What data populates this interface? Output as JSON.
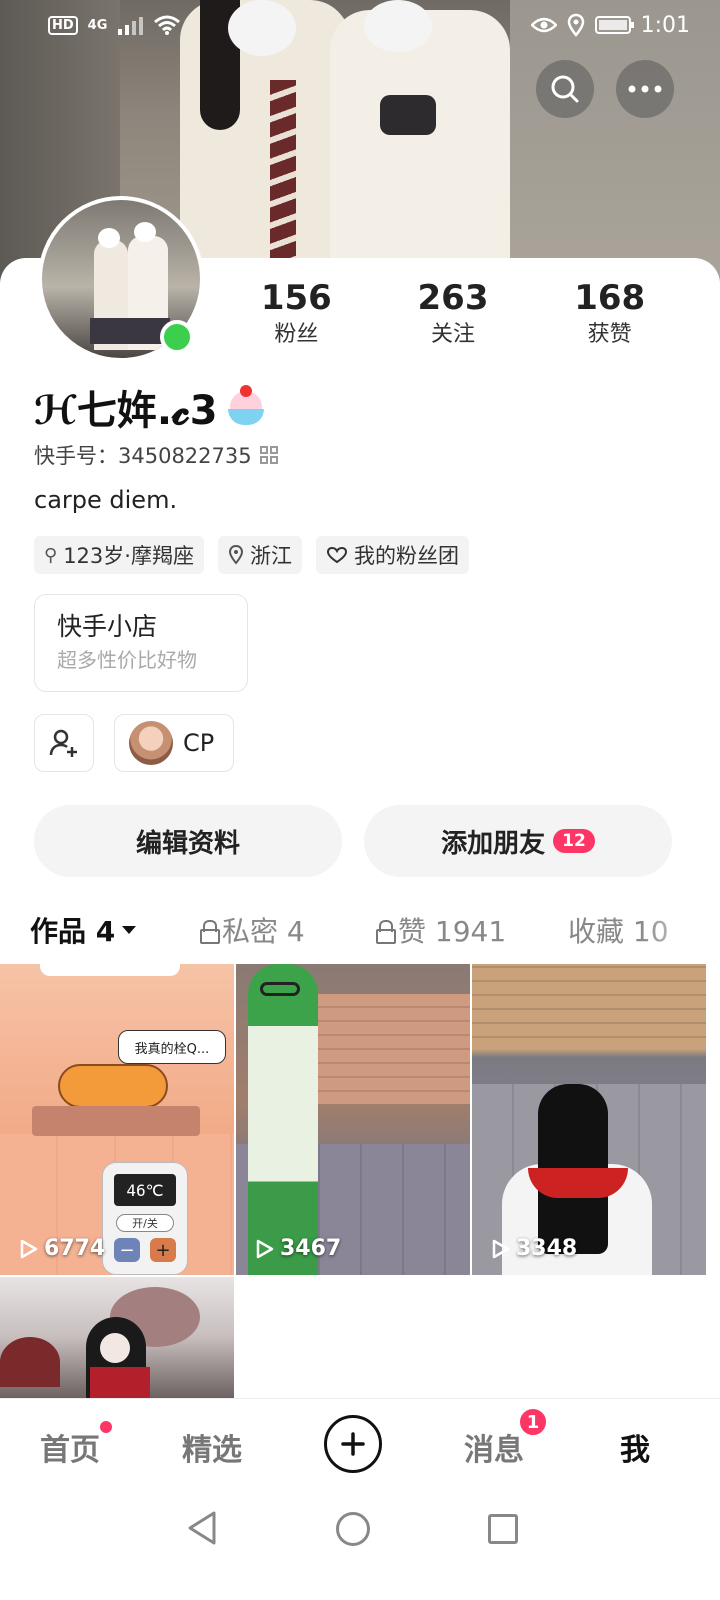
{
  "status_bar": {
    "network_badge": "HD",
    "network_type": "4G",
    "time": "1:01"
  },
  "header": {
    "search_icon": "search-icon",
    "more_icon": "more-icon"
  },
  "profile": {
    "nickname": "ℋ七姩.𝓬3",
    "kuaishou_id_label": "快手号：",
    "kuaishou_id": "3450822735",
    "bio": "carpe diem.",
    "online": true,
    "online_color": "#3ccf4e"
  },
  "stats": [
    {
      "value": "156",
      "label": "粉丝"
    },
    {
      "value": "263",
      "label": "关注"
    },
    {
      "value": "168",
      "label": "获赞"
    }
  ],
  "tags": [
    {
      "icon": "gender-icon",
      "label": "123岁·摩羯座"
    },
    {
      "icon": "location-icon",
      "label": "浙江"
    },
    {
      "icon": "heart-icon",
      "label": "我的粉丝团"
    }
  ],
  "shop": {
    "title": "快手小店",
    "subtitle": "超多性价比好物"
  },
  "cp": {
    "label": "CP"
  },
  "actions": {
    "edit_profile": "编辑资料",
    "add_friends": "添加朋友",
    "add_friends_badge": "12"
  },
  "tabs": [
    {
      "label": "作品 4",
      "locked": false,
      "active": true
    },
    {
      "label": "私密 4",
      "locked": true,
      "active": false
    },
    {
      "label": "赞 1941",
      "locked": true,
      "active": false
    },
    {
      "label": "收藏 10",
      "locked": false,
      "active": false
    }
  ],
  "works": [
    {
      "plays": "6774",
      "bubble_text": "我真的栓Q...",
      "remote_temp": "46℃",
      "remote_button": "开/关"
    },
    {
      "plays": "3467"
    },
    {
      "plays": "3348"
    },
    {
      "plays": ""
    }
  ],
  "bottom_nav": {
    "items": [
      "首页",
      "精选",
      "消息",
      "我"
    ],
    "messages_badge": "1",
    "accent_color": "#fe3666"
  }
}
